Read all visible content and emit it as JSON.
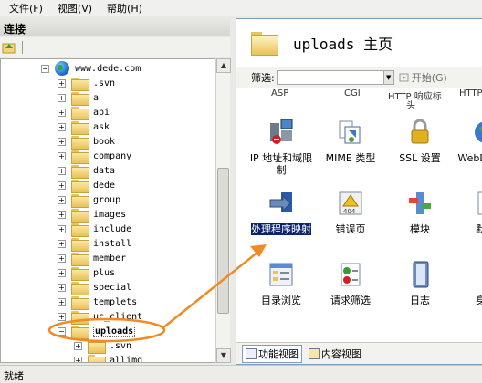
{
  "menu": [
    "文件(F)",
    "视图(V)",
    "帮助(H)"
  ],
  "left_panel": {
    "title": "连接",
    "tree": [
      {
        "label": "www.dede.com",
        "type": "site",
        "expander": "-"
      },
      {
        "label": ".svn",
        "expander": "+"
      },
      {
        "label": "a",
        "expander": "+"
      },
      {
        "label": "api",
        "expander": "+"
      },
      {
        "label": "ask",
        "expander": "+"
      },
      {
        "label": "book",
        "expander": "+"
      },
      {
        "label": "company",
        "expander": "+"
      },
      {
        "label": "data",
        "expander": "+"
      },
      {
        "label": "dede",
        "expander": "+"
      },
      {
        "label": "group",
        "expander": "+"
      },
      {
        "label": "images",
        "expander": "+"
      },
      {
        "label": "include",
        "expander": "+"
      },
      {
        "label": "install",
        "expander": "+"
      },
      {
        "label": "member",
        "expander": "+"
      },
      {
        "label": "plus",
        "expander": "+"
      },
      {
        "label": "special",
        "expander": "+"
      },
      {
        "label": "templets",
        "expander": "+"
      },
      {
        "label": "uc_client",
        "expander": "+"
      },
      {
        "label": "uploads",
        "expander": "-",
        "selected": true
      },
      {
        "label": ".svn",
        "expander": "+",
        "child": true
      },
      {
        "label": "allimg",
        "expander": "+",
        "child": true
      }
    ]
  },
  "content": {
    "title": "uploads 主页",
    "filter_label": "筛选:",
    "start_label": "开始(G)",
    "top_cutoff": [
      "ASP",
      "CGI",
      "HTTP 响应标",
      "头",
      "HTTP"
    ],
    "features": [
      {
        "label": "IP 地址和域限制",
        "icon": "ip-restrictions-icon"
      },
      {
        "label": "MIME 类型",
        "icon": "mime-types-icon"
      },
      {
        "label": "SSL 设置",
        "icon": "ssl-lock-icon"
      },
      {
        "label": "WebDAV 规",
        "icon": "webdav-icon"
      },
      {
        "label": "处理程序映射",
        "icon": "handler-mappings-icon",
        "selected": true
      },
      {
        "label": "错误页",
        "icon": "error-pages-icon"
      },
      {
        "label": "模块",
        "icon": "modules-icon"
      },
      {
        "label": "默认",
        "icon": "default-document-icon"
      },
      {
        "label": "目录浏览",
        "icon": "directory-browsing-icon"
      },
      {
        "label": "请求筛选",
        "icon": "request-filtering-icon"
      },
      {
        "label": "日志",
        "icon": "logging-icon"
      },
      {
        "label": "身份",
        "icon": "authentication-icon"
      }
    ],
    "tabs": [
      "功能视图",
      "内容视图"
    ]
  },
  "status": "就绪",
  "colors": {
    "annotation": "#f08a24",
    "selection": "#0a246a"
  }
}
